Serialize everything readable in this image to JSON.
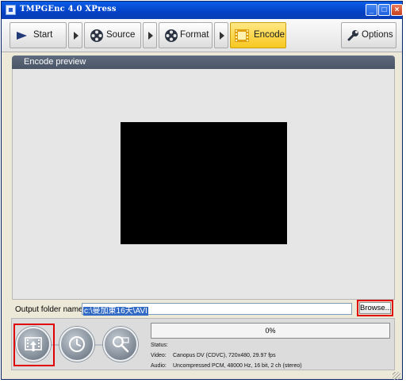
{
  "window": {
    "title": "TMPGEnc 4.0 XPress",
    "minimize": "_",
    "maximize": "□",
    "close": "×"
  },
  "toolbar": {
    "start_label": "Start",
    "source_label": "Source",
    "format_label": "Format",
    "encode_label": "Encode",
    "options_label": "Options",
    "active_step": "Encode",
    "active_color": "#f8c820"
  },
  "preview": {
    "header": "Encode preview"
  },
  "output": {
    "label": "Output folder name:",
    "value": "c:\\曼加東16天\\AVI",
    "browse_label": "Browse..."
  },
  "encoding": {
    "progress_text": "0%",
    "progress_percent": 0,
    "status_label": "Status:",
    "status_value": "",
    "video_label": "Video:",
    "video_value": "Canopus DV (CDVC), 720x480, 29.97 fps",
    "audio_label": "Audio:",
    "audio_value": "Uncompressed PCM, 48000 Hz, 16 bit, 2 ch (stereo)"
  },
  "icons": {
    "start": "play-arrow-icon",
    "source": "film-reel-icon",
    "format": "film-reel-icon",
    "encode": "film-strip-icon",
    "options": "wrench-icon",
    "encode_button": "film-upload-icon",
    "timer_button": "clock-icon",
    "preview_button": "search-film-icon"
  },
  "highlight_color": "#e00000"
}
